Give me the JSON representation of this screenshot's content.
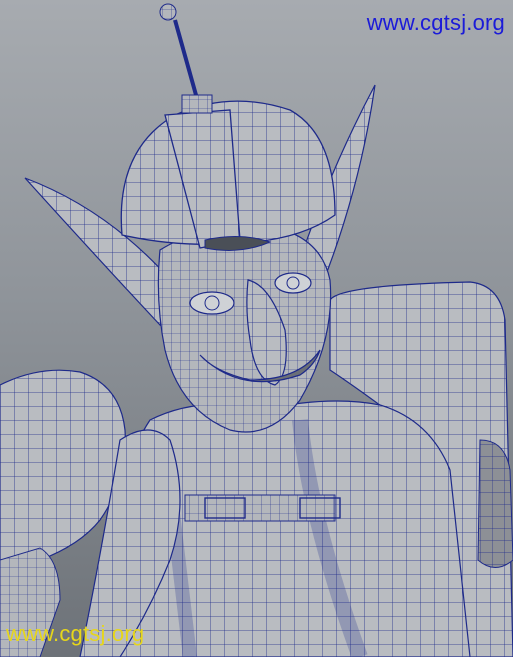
{
  "watermarks": {
    "top": "www.cgtsj.org",
    "bottom": "www.cgtsj.org"
  },
  "colors": {
    "background_top": "#a7abb0",
    "background_bottom": "#6d7278",
    "mesh_fill": "#b9bcc1",
    "wireframe": "#1e2a8a",
    "watermark_top": "#1b1bd8",
    "watermark_bottom": "#e6d61a"
  }
}
